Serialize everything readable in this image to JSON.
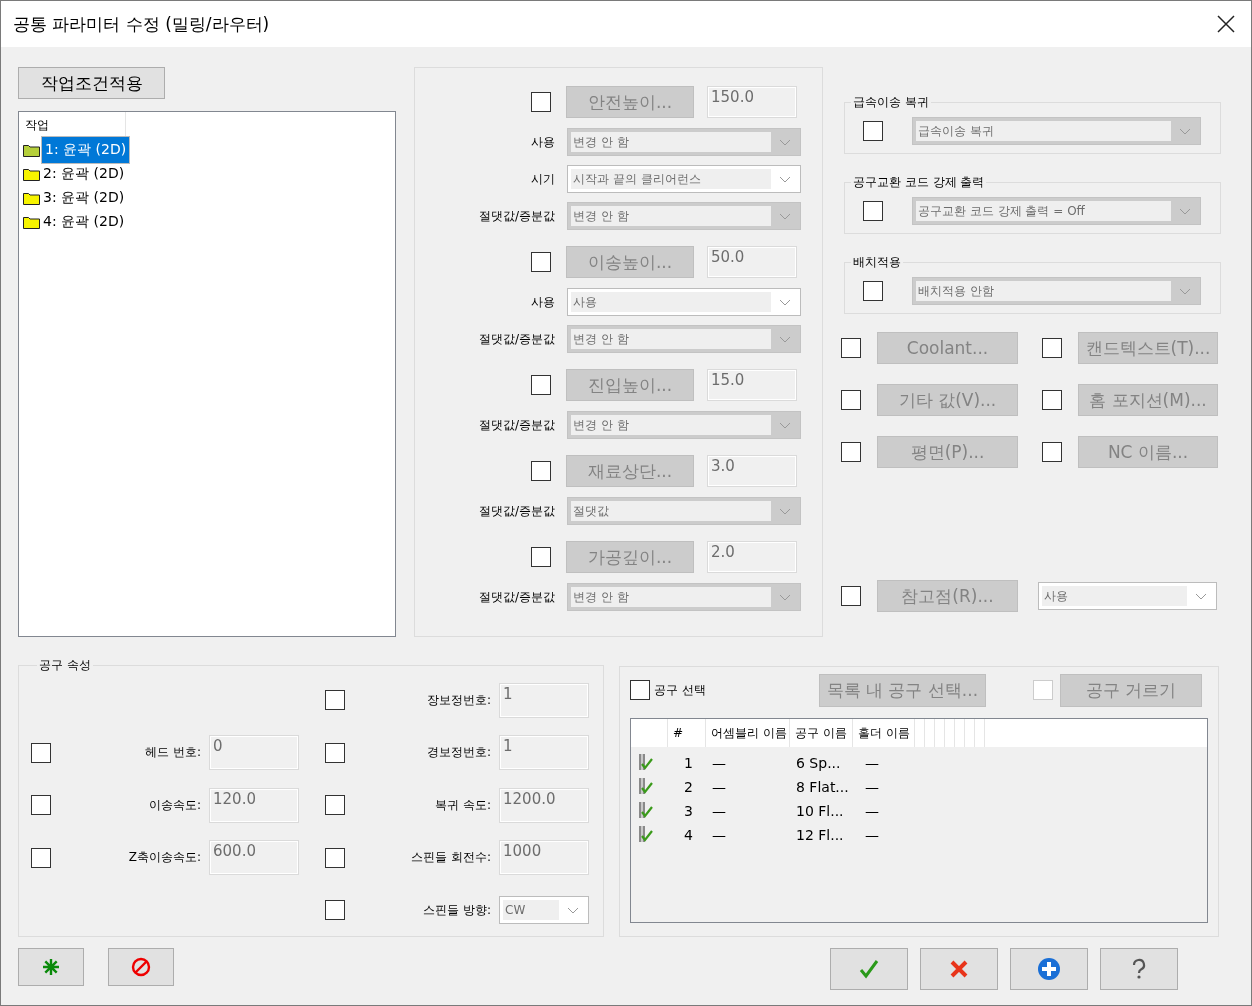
{
  "window": {
    "title": "공통 파라미터 수정 (밀링/라우터)"
  },
  "apply_button": {
    "label": "작업조건적용"
  },
  "tree": {
    "header": "작업",
    "items": [
      {
        "label": "1: 윤곽 (2D)",
        "selected": true
      },
      {
        "label": "2: 윤곽 (2D)",
        "selected": false
      },
      {
        "label": "3: 윤곽 (2D)",
        "selected": false
      },
      {
        "label": "4: 윤곽 (2D)",
        "selected": false
      }
    ]
  },
  "height_params": [
    {
      "checked": false,
      "button": {
        "label": "안전높이...",
        "disabled": true
      },
      "value": "150.0",
      "options": [
        {
          "label": "사용",
          "value": "변경 안 함",
          "disabled": true
        },
        {
          "label": "시기",
          "value": "시작과 끝의 클리어런스",
          "disabled": false
        },
        {
          "label": "절댓값/증분값",
          "value": "변경 안 함",
          "disabled": true
        }
      ]
    },
    {
      "checked": false,
      "button": {
        "label": "이송높이...",
        "disabled": true
      },
      "value": "50.0",
      "options": [
        {
          "label": "사용",
          "value": "사용",
          "disabled": false
        },
        {
          "label": "절댓값/증분값",
          "value": "변경 안 함",
          "disabled": true
        }
      ]
    },
    {
      "checked": false,
      "button": {
        "label": "진입높이...",
        "disabled": true
      },
      "value": "15.0",
      "options": [
        {
          "label": "절댓값/증분값",
          "value": "변경 안 함",
          "disabled": true
        }
      ]
    },
    {
      "checked": false,
      "button": {
        "label": "재료상단...",
        "disabled": true
      },
      "value": "3.0",
      "options": [
        {
          "label": "절댓값/증분값",
          "value": "절댓값",
          "disabled": true
        }
      ]
    },
    {
      "checked": false,
      "button": {
        "label": "가공깊이...",
        "disabled": true
      },
      "value": "2.0",
      "options": [
        {
          "label": "절댓값/증분값",
          "value": "변경 안 함",
          "disabled": true
        }
      ]
    }
  ],
  "groups": [
    {
      "legend": "급속이송 복귀",
      "checked": false,
      "select": {
        "value": "급속이송 복귀",
        "disabled": true
      }
    },
    {
      "legend": "공구교환 코드 강제 출력",
      "checked": false,
      "select": {
        "value": "공구교환 코드 강제 출력 = Off",
        "disabled": true
      }
    },
    {
      "legend": "배치적용",
      "checked": false,
      "select": {
        "value": "배치적용 안함",
        "disabled": true
      }
    }
  ],
  "option_buttons": [
    {
      "checked": false,
      "label": "Coolant...",
      "disabled": true
    },
    {
      "checked": false,
      "label": "캔드텍스트(T)...",
      "disabled": true
    },
    {
      "checked": false,
      "label": "기타 값(V)...",
      "disabled": true
    },
    {
      "checked": false,
      "label": "홈 포지션(M)...",
      "disabled": true
    },
    {
      "checked": false,
      "label": "평면(P)...",
      "disabled": true
    },
    {
      "checked": false,
      "label": "NC 이름...",
      "disabled": true
    }
  ],
  "reference": {
    "checked": false,
    "button": {
      "label": "참고점(R)...",
      "disabled": true
    },
    "select": {
      "value": "사용",
      "disabled": false
    }
  },
  "tool_properties": {
    "legend": "공구 속성",
    "rows": [
      {
        "right": {
          "kind": "field",
          "checked": false,
          "label": "장보정번호:",
          "value": "1"
        }
      },
      {
        "left": {
          "checked": false,
          "label": "헤드 번호:",
          "value": "0"
        },
        "right": {
          "kind": "field",
          "checked": false,
          "label": "경보정번호:",
          "value": "1"
        }
      },
      {
        "left": {
          "checked": false,
          "label": "이송속도:",
          "value": "120.0"
        },
        "right": {
          "kind": "field",
          "checked": false,
          "label": "복귀 속도:",
          "value": "1200.0"
        }
      },
      {
        "left": {
          "checked": false,
          "label": "Z축이송속도:",
          "value": "600.0"
        },
        "right": {
          "kind": "field",
          "checked": false,
          "label": "스핀들 회전수:",
          "value": "1000"
        }
      },
      {
        "right": {
          "kind": "select",
          "checked": false,
          "label": "스핀들 방향:",
          "value": "CW",
          "disabled": false
        }
      }
    ]
  },
  "tool_selection": {
    "checkbox": {
      "label": "공구 선택",
      "checked": false
    },
    "select_button": {
      "label": "목록 내 공구 선택...",
      "disabled": true
    },
    "filter_checked": false,
    "filter_button": {
      "label": "공구 거르기",
      "disabled": true
    },
    "table": {
      "columns": [
        "#",
        "어셈블리 이름",
        "공구 이름",
        "홀더 이름"
      ],
      "rows": [
        {
          "cells": [
            "1",
            "—",
            "6 Sp...",
            "—"
          ]
        },
        {
          "cells": [
            "2",
            "—",
            "8 Flat...",
            "—"
          ]
        },
        {
          "cells": [
            "3",
            "—",
            "10 Fl...",
            "—"
          ]
        },
        {
          "cells": [
            "4",
            "—",
            "12 Fl...",
            "—"
          ]
        }
      ]
    }
  }
}
